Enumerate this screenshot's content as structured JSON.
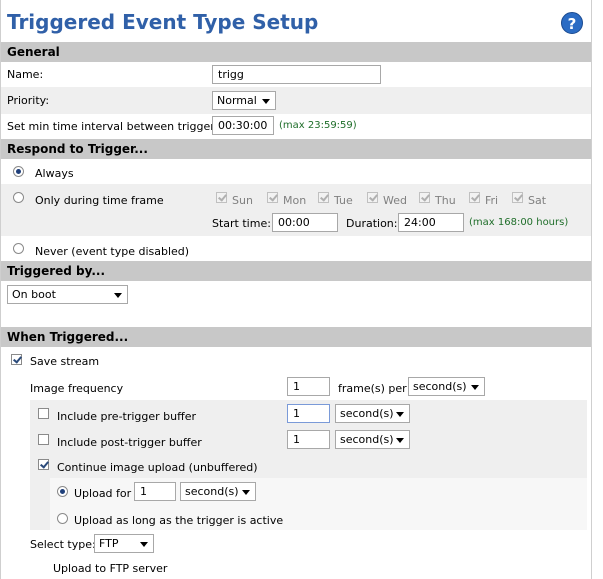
{
  "header": {
    "title": "Triggered Event Type Setup",
    "help": "?"
  },
  "general": {
    "heading": "General",
    "name_label": "Name:",
    "name_value": "trigg",
    "priority_label": "Priority:",
    "priority_value": "Normal",
    "interval_label": "Set min time interval between triggers:",
    "interval_value": "00:30:00",
    "interval_note": "(max 23:59:59)"
  },
  "respond": {
    "heading": "Respond to Trigger...",
    "always": "Always",
    "timeframe": "Only during time frame",
    "days": [
      "Sun",
      "Mon",
      "Tue",
      "Wed",
      "Thu",
      "Fri",
      "Sat"
    ],
    "start_label": "Start time:",
    "start_value": "00:00",
    "duration_label": "Duration:",
    "duration_value": "24:00",
    "duration_note": "(max 168:00 hours)",
    "never": "Never (event type disabled)"
  },
  "triggered_by": {
    "heading": "Triggered by...",
    "value": "On boot"
  },
  "when": {
    "heading": "When Triggered...",
    "save_stream": "Save stream",
    "image_freq_label": "Image frequency",
    "image_freq_value": "1",
    "frames_per": "frame(s) per",
    "freq_unit": "second(s)",
    "pre_label": "Include pre-trigger buffer",
    "pre_value": "1",
    "pre_unit": "second(s)",
    "post_label": "Include post-trigger buffer",
    "post_value": "1",
    "post_unit": "second(s)",
    "continue_label": "Continue image upload (unbuffered)",
    "upload_for": "Upload for",
    "upload_value": "1",
    "upload_unit": "second(s)",
    "upload_active": "Upload as long as the trigger is active",
    "select_type_label": "Select type:",
    "select_type_value": "FTP",
    "ftp_label": "Upload to FTP server"
  },
  "colors": {
    "title": "#3060a8",
    "section_bg": "#c8c8c8",
    "note": "#1f6e2a"
  }
}
